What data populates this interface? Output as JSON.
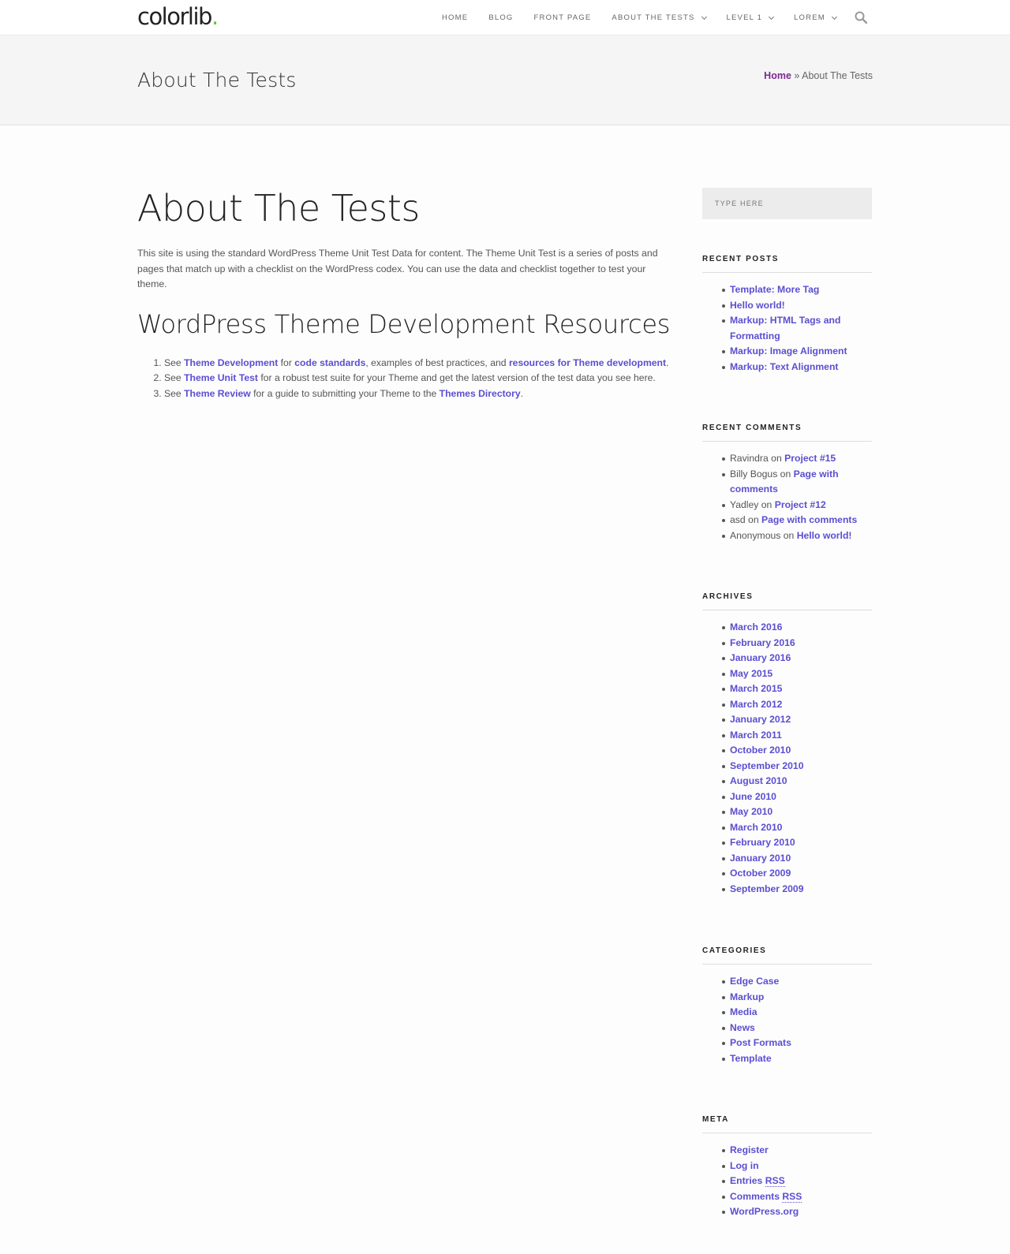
{
  "header": {
    "logo_text": "colorlib",
    "logo_dot": ".",
    "nav": [
      {
        "label": "HOME"
      },
      {
        "label": "BLOG"
      },
      {
        "label": "FRONT PAGE"
      },
      {
        "label": "ABOUT THE TESTS"
      },
      {
        "label": "LEVEL 1"
      },
      {
        "label": "LOREM"
      }
    ]
  },
  "titlebar": {
    "title": "About The Tests",
    "breadcrumb_home": "Home",
    "breadcrumb_sep": " » ",
    "breadcrumb_current": "About The Tests"
  },
  "main": {
    "title": "About The Tests",
    "intro": "This site is using the standard WordPress Theme Unit Test Data for content. The Theme Unit Test is a series of posts and pages that match up with a checklist on the WordPress codex. You can use the data and checklist together to test your theme.",
    "section_title": "WordPress Theme Development Resources",
    "list": {
      "item1": {
        "pre": "See ",
        "link1": "Theme Development",
        "mid1": " for ",
        "link2": "code standards",
        "mid2": ", examples of best practices, and ",
        "link3": "resources for Theme development",
        "post": "."
      },
      "item2": {
        "pre": "See ",
        "link1": "Theme Unit Test",
        "post": " for a robust test suite for your Theme and get the latest version of the test data you see here."
      },
      "item3": {
        "pre": "See ",
        "link1": "Theme Review",
        "mid1": " for a guide to submitting your Theme to the ",
        "link2": "Themes Directory",
        "post": "."
      }
    }
  },
  "sidebar": {
    "search_placeholder": "TYPE HERE",
    "recent_posts": {
      "title": "RECENT POSTS",
      "items": [
        "Template: More Tag",
        "Hello world!",
        "Markup: HTML Tags and Formatting",
        "Markup: Image Alignment",
        "Markup: Text Alignment"
      ]
    },
    "recent_comments": {
      "title": "RECENT COMMENTS",
      "connector": " on ",
      "items": [
        {
          "author": "Ravindra",
          "post": "Project #15"
        },
        {
          "author": "Billy Bogus",
          "post": "Page with comments"
        },
        {
          "author": "Yadley",
          "post": "Project #12"
        },
        {
          "author": "asd",
          "post": "Page with comments"
        },
        {
          "author": "Anonymous",
          "post": "Hello world!"
        }
      ]
    },
    "archives": {
      "title": "ARCHIVES",
      "items": [
        "March 2016",
        "February 2016",
        "January 2016",
        "May 2015",
        "March 2015",
        "March 2012",
        "January 2012",
        "March 2011",
        "October 2010",
        "September 2010",
        "August 2010",
        "June 2010",
        "May 2010",
        "March 2010",
        "February 2010",
        "January 2010",
        "October 2009",
        "September 2009"
      ]
    },
    "categories": {
      "title": "CATEGORIES",
      "items": [
        "Edge Case",
        "Markup",
        "Media",
        "News",
        "Post Formats",
        "Template"
      ]
    },
    "meta": {
      "title": "META",
      "register": "Register",
      "login": "Log in",
      "entries": "Entries",
      "comments": "Comments",
      "rss": "RSS",
      "wordpress": "WordPress.org"
    }
  },
  "colors": {
    "link": "#5a4fd1",
    "breadcrumb_link": "#7b2a8f",
    "logo_dot": "#6bbf3a"
  }
}
